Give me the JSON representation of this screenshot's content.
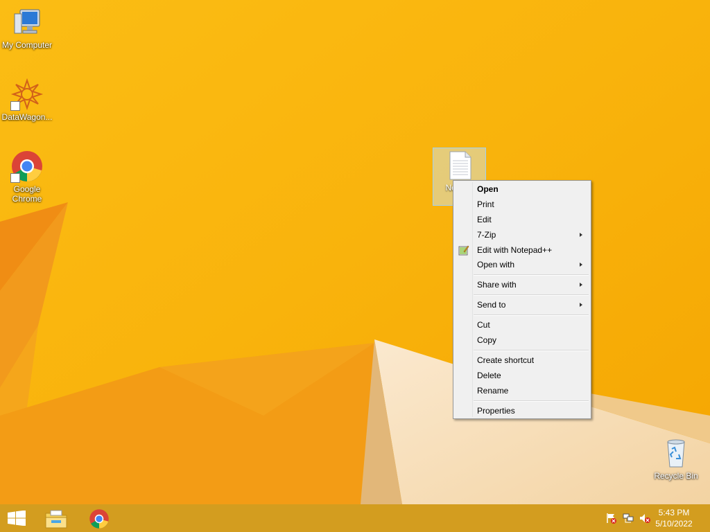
{
  "desktop": {
    "icons": [
      {
        "label": "My Computer",
        "icon": "computer-icon"
      },
      {
        "label": "DataWagon...",
        "icon": "datawagon-icon"
      },
      {
        "label": "Google Chrome",
        "icon": "chrome-icon"
      },
      {
        "label": "Recycle Bin",
        "icon": "recycle-bin-icon"
      }
    ],
    "selected_file": {
      "label": "New Text Document.txt",
      "visible_label": "Ne Doc",
      "icon": "text-file-icon"
    }
  },
  "context_menu": {
    "items": [
      {
        "label": "Open",
        "bold": true
      },
      {
        "label": "Print"
      },
      {
        "label": "Edit"
      },
      {
        "label": "7-Zip",
        "submenu": true
      },
      {
        "label": "Edit with Notepad++",
        "icon": "notepadpp-icon"
      },
      {
        "label": "Open with",
        "submenu": true
      },
      {
        "label": "Share with",
        "submenu": true
      },
      {
        "label": "Send to",
        "submenu": true
      },
      {
        "label": "Cut"
      },
      {
        "label": "Copy"
      },
      {
        "label": "Create shortcut"
      },
      {
        "label": "Delete"
      },
      {
        "label": "Rename"
      },
      {
        "label": "Properties"
      }
    ]
  },
  "taskbar": {
    "pinned": [
      "start-icon",
      "file-explorer-icon",
      "chrome-icon"
    ],
    "tray": [
      "action-center-flag-icon",
      "network-icon",
      "volume-muted-icon"
    ],
    "clock": {
      "time": "5:43 PM",
      "date": "5/10/2022"
    }
  },
  "colors": {
    "wallpaper": "#f7b50b",
    "taskbar": "#d39d1f",
    "menu_bg": "#f0f0f0"
  }
}
